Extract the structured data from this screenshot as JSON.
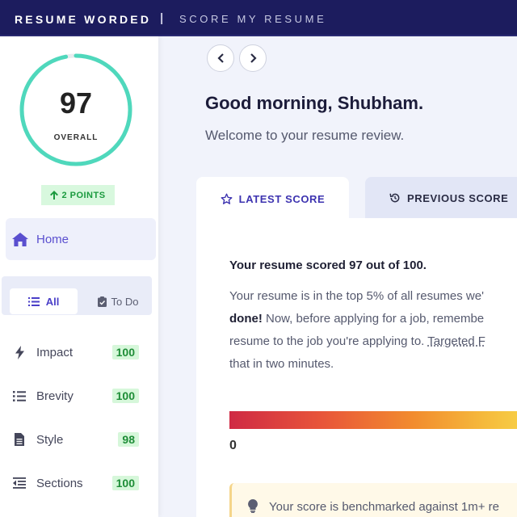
{
  "header": {
    "brand": "RESUME WORDED",
    "divider": "|",
    "subtitle": "SCORE MY RESUME"
  },
  "sidebar": {
    "score": "97",
    "score_fraction": 0.97,
    "score_label": "OVERALL",
    "points": "2 POINTS",
    "home_label": "Home",
    "filters": {
      "all": "All",
      "todo": "To Do"
    },
    "categories": [
      {
        "label": "Impact",
        "value": "100",
        "icon": "bolt-icon"
      },
      {
        "label": "Brevity",
        "value": "100",
        "icon": "list-icon"
      },
      {
        "label": "Style",
        "value": "98",
        "icon": "document-icon"
      },
      {
        "label": "Sections",
        "value": "100",
        "icon": "indent-icon"
      }
    ]
  },
  "main": {
    "greeting": "Good morning, Shubham.",
    "welcome": "Welcome to your resume review.",
    "tabs": {
      "latest": "LATEST SCORE",
      "previous": "PREVIOUS SCORE"
    },
    "scored_text": "Your resume scored 97 out of 100.",
    "para_line1": "Your resume is in the top 5% of all resumes we'",
    "para_line2a": "done!",
    "para_line2b": " Now, before applying for a job, remembe",
    "para_line3a": "resume to the job you're applying to. ",
    "para_line3b": "Targeted F",
    "para_line4": "that in two minutes.",
    "scale_min": "0",
    "benchmark": "Your score is benchmarked against 1m+ re"
  },
  "colors": {
    "accent": "#4a3fc8",
    "ring": "#4fd8bc",
    "header_bg": "#1c1c5e",
    "badge_bg": "#d6f7da"
  }
}
